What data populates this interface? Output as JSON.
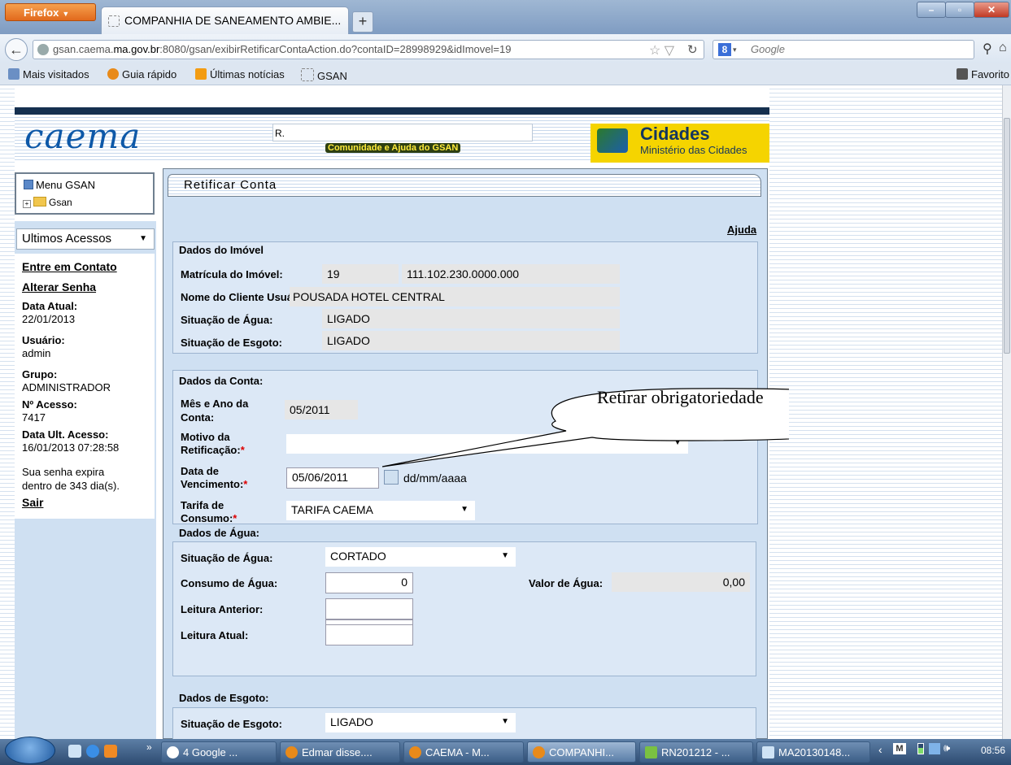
{
  "browser": {
    "menu_button": "Firefox",
    "tab_title": "COMPANHIA DE SANEAMENTO AMBIE...",
    "newtab_glyph": "+",
    "url_prefix": "gsan.caema.",
    "url_domain": "ma.gov.br",
    "url_rest": ":8080/gsan/exibirRetificarContaAction.do?contaID=28998929&idImovel=19",
    "search_placeholder": "Google",
    "bookmarks": [
      "Mais visitados",
      "Guia rápido",
      "Últimas notícias",
      "GSAN"
    ],
    "favorites": "Favorito"
  },
  "header": {
    "logo": "caema",
    "top_input_value": "R.",
    "community_link": "Comunidade e Ajuda do GSAN",
    "cidades_title": "Cidades",
    "cidades_subtitle": "Ministério das Cidades"
  },
  "menu": {
    "title": "Menu GSAN",
    "tree_root": "Gsan",
    "recent_select": "Ultimos Acessos"
  },
  "sidebar": {
    "contact_link": "Entre em Contato",
    "change_password_link": "Alterar Senha",
    "current_date_label": "Data Atual:",
    "current_date": "22/01/2013",
    "user_label": "Usuário:",
    "user": "admin",
    "group_label": "Grupo:",
    "group": "ADMINISTRADOR",
    "access_no_label": "Nº Acesso:",
    "access_no": "7417",
    "last_access_label": "Data Ult. Acesso:",
    "last_access": "16/01/2013 07:28:58",
    "password_expiry_1": "Sua senha expira",
    "password_expiry_2": "dentro de 343 dia(s).",
    "logout_link": "Sair"
  },
  "form": {
    "title": "Retificar Conta",
    "help_link": "Ajuda",
    "imovel": {
      "section": "Dados do Imóvel",
      "matricula_label": "Matrícula do Imóvel:",
      "matricula": "19",
      "inscricao": "111.102.230.0000.000",
      "cliente_label": "Nome do Cliente Usuário:",
      "cliente": "POUSADA HOTEL CENTRAL",
      "agua_label": "Situação de Água:",
      "agua": "LIGADO",
      "esgoto_label": "Situação de Esgoto:",
      "esgoto": "LIGADO"
    },
    "conta": {
      "section": "Dados da Conta:",
      "mes_ano_label_1": "Mês e Ano da",
      "mes_ano_label_2": "Conta:",
      "mes_ano": "05/2011",
      "motivo_label_1": "Motivo da",
      "motivo_label_2": "Retificação:",
      "motivo": "",
      "vencimento_label_1": "Data de",
      "vencimento_label_2": "Vencimento:",
      "vencimento": "05/06/2011",
      "date_hint": "dd/mm/aaaa",
      "tarifa_label_1": "Tarifa de",
      "tarifa_label_2": "Consumo:",
      "tarifa": "TARIFA CAEMA",
      "required_mark": "*"
    },
    "agua": {
      "section": "Dados de Água:",
      "situacao_label": "Situação de Água:",
      "situacao": "CORTADO",
      "consumo_label": "Consumo de Água:",
      "consumo": "0",
      "valor_label": "Valor de Água:",
      "valor": "0,00",
      "leitura_anterior_label": "Leitura Anterior:",
      "leitura_anterior": "",
      "leitura_atual_label": "Leitura Atual:",
      "leitura_atual": ""
    },
    "esgoto": {
      "section": "Dados de Esgoto:",
      "situacao_label": "Situação de Esgoto:",
      "situacao": "LIGADO"
    }
  },
  "callout": "Retirar obrigatoriedade",
  "taskbar": {
    "items": [
      "4 Google ...",
      "Edmar disse....",
      "CAEMA - M...",
      "COMPANHI...",
      "RN201212 - ...",
      "MA20130148..."
    ],
    "clock": "08:56"
  }
}
